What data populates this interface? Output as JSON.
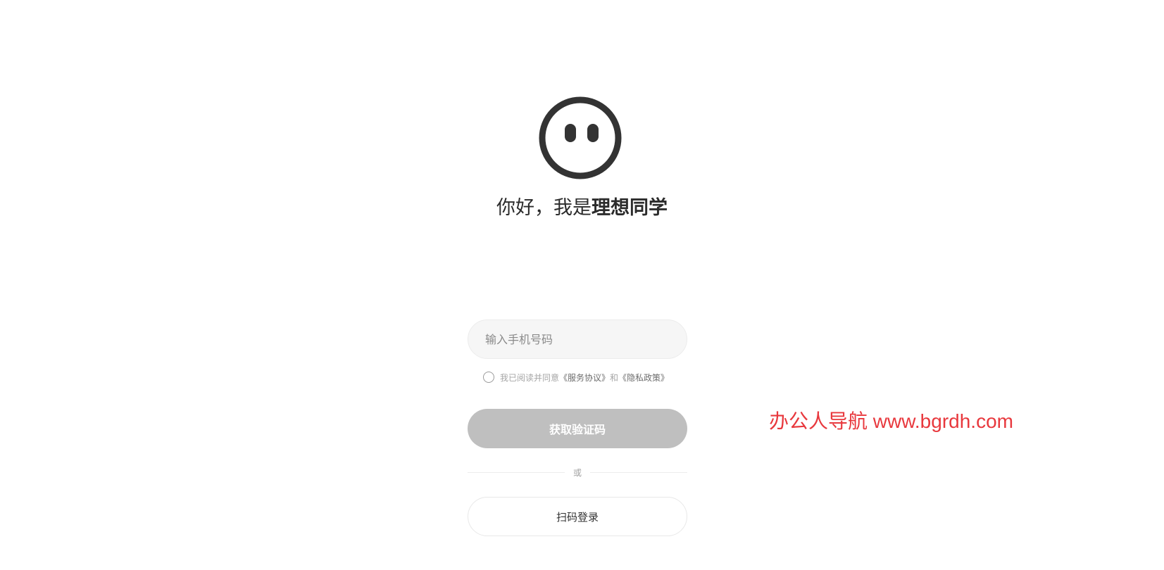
{
  "greeting": {
    "prefix": "你好，我是",
    "name": "理想同学"
  },
  "phone": {
    "placeholder": "输入手机号码",
    "value": ""
  },
  "agreement": {
    "text": "我已阅读并同意",
    "service_link": "《服务协议》",
    "and": "和",
    "privacy_link": "《隐私政策》",
    "checked": false
  },
  "buttons": {
    "get_code": "获取验证码",
    "or": "或",
    "scan_login": "扫码登录"
  },
  "watermark": "办公人导航 www.bgrdh.com",
  "colors": {
    "logo": "#333333",
    "button_disabled": "#bfbfbf",
    "input_bg": "#f6f6f6",
    "watermark": "#e8383d"
  }
}
